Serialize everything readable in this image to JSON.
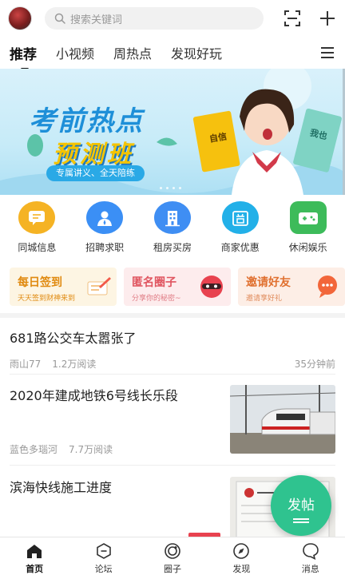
{
  "search": {
    "placeholder": "搜索关键词"
  },
  "tabs": [
    {
      "label": "推荐",
      "active": true
    },
    {
      "label": "小视频"
    },
    {
      "label": "周热点"
    },
    {
      "label": "发现好玩"
    }
  ],
  "banner": {
    "title_line1": "考前热点",
    "title_line2": "预测班",
    "pill": "专属讲义、全天陪练",
    "book_left": "自信",
    "book_right": "我也"
  },
  "quick_entries": [
    {
      "label": "同城信息",
      "icon": "chat-bubble-icon",
      "color": "#f5b324"
    },
    {
      "label": "招聘求职",
      "icon": "person-icon",
      "color": "#3b8ff5"
    },
    {
      "label": "租房买房",
      "icon": "building-icon",
      "color": "#3f8ef3"
    },
    {
      "label": "商家优惠",
      "icon": "shop-icon",
      "color": "#22b0e8"
    },
    {
      "label": "休闲娱乐",
      "icon": "game-icon",
      "color": "#3dbb5a"
    }
  ],
  "features": [
    {
      "title": "每日签到",
      "sub": "天天签到财神来到",
      "bg": "#fdf5e3",
      "color": "#e08a10"
    },
    {
      "title": "匿名圈子",
      "sub": "分享你的秘密~",
      "bg": "#fdeced",
      "color": "#e05560"
    },
    {
      "title": "邀请好友",
      "sub": "邀请享好礼",
      "bg": "#fdeee6",
      "color": "#e0702f"
    }
  ],
  "feed": [
    {
      "title": "681路公交车太嚣张了",
      "author": "雨山77",
      "reads": "1.2万阅读",
      "time": "35分钟前"
    },
    {
      "title": "2020年建成地铁6号线长乐段",
      "author": "蓝色多瑙河",
      "reads": "7.7万阅读"
    },
    {
      "title": "滨海快线施工进度",
      "author": "",
      "reads": ""
    }
  ],
  "fab": {
    "label": "发帖"
  },
  "bottom_nav": [
    {
      "label": "首页",
      "active": true
    },
    {
      "label": "论坛"
    },
    {
      "label": "圈子"
    },
    {
      "label": "发现"
    },
    {
      "label": "消息"
    }
  ]
}
